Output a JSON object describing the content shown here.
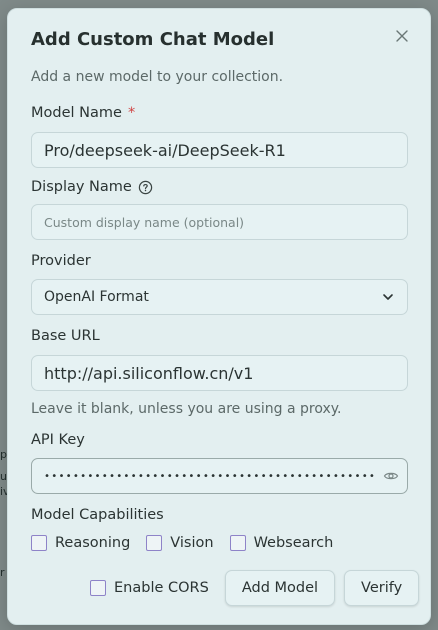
{
  "backdrop": {
    "fragments": [
      "p",
      "ul",
      "iv",
      "i",
      "r",
      "n",
      "p"
    ]
  },
  "modal": {
    "title": "Add Custom Chat Model",
    "subtitle": "Add a new model to your collection.",
    "fields": {
      "model_name": {
        "label": "Model Name",
        "required_mark": "*",
        "value": "Pro/deepseek-ai/DeepSeek-R1"
      },
      "display_name": {
        "label": "Display Name",
        "placeholder": "Custom display name (optional)",
        "value": ""
      },
      "provider": {
        "label": "Provider",
        "selected": "OpenAI Format"
      },
      "base_url": {
        "label": "Base URL",
        "value": "http://api.siliconflow.cn/v1",
        "hint": "Leave it blank, unless you are using a proxy."
      },
      "api_key": {
        "label": "API Key",
        "masked": "•••••••••••••••••••••••••••••••••••••••••••••••••••"
      }
    },
    "capabilities": {
      "label": "Model Capabilities",
      "items": [
        {
          "label": "Reasoning",
          "checked": false
        },
        {
          "label": "Vision",
          "checked": false
        },
        {
          "label": "Websearch",
          "checked": false
        }
      ]
    },
    "footer": {
      "enable_cors": {
        "label": "Enable CORS",
        "checked": false
      },
      "add_model_label": "Add Model",
      "verify_label": "Verify"
    }
  },
  "colors": {
    "backdrop": "#7f8a89",
    "modal_bg": "#e3eff0",
    "required": "#d14545",
    "checkbox_border": "#8e83c8"
  },
  "icons": {
    "close": "close-icon",
    "help": "help-circle-icon",
    "chevron": "chevron-down-icon",
    "eye": "eye-icon"
  }
}
